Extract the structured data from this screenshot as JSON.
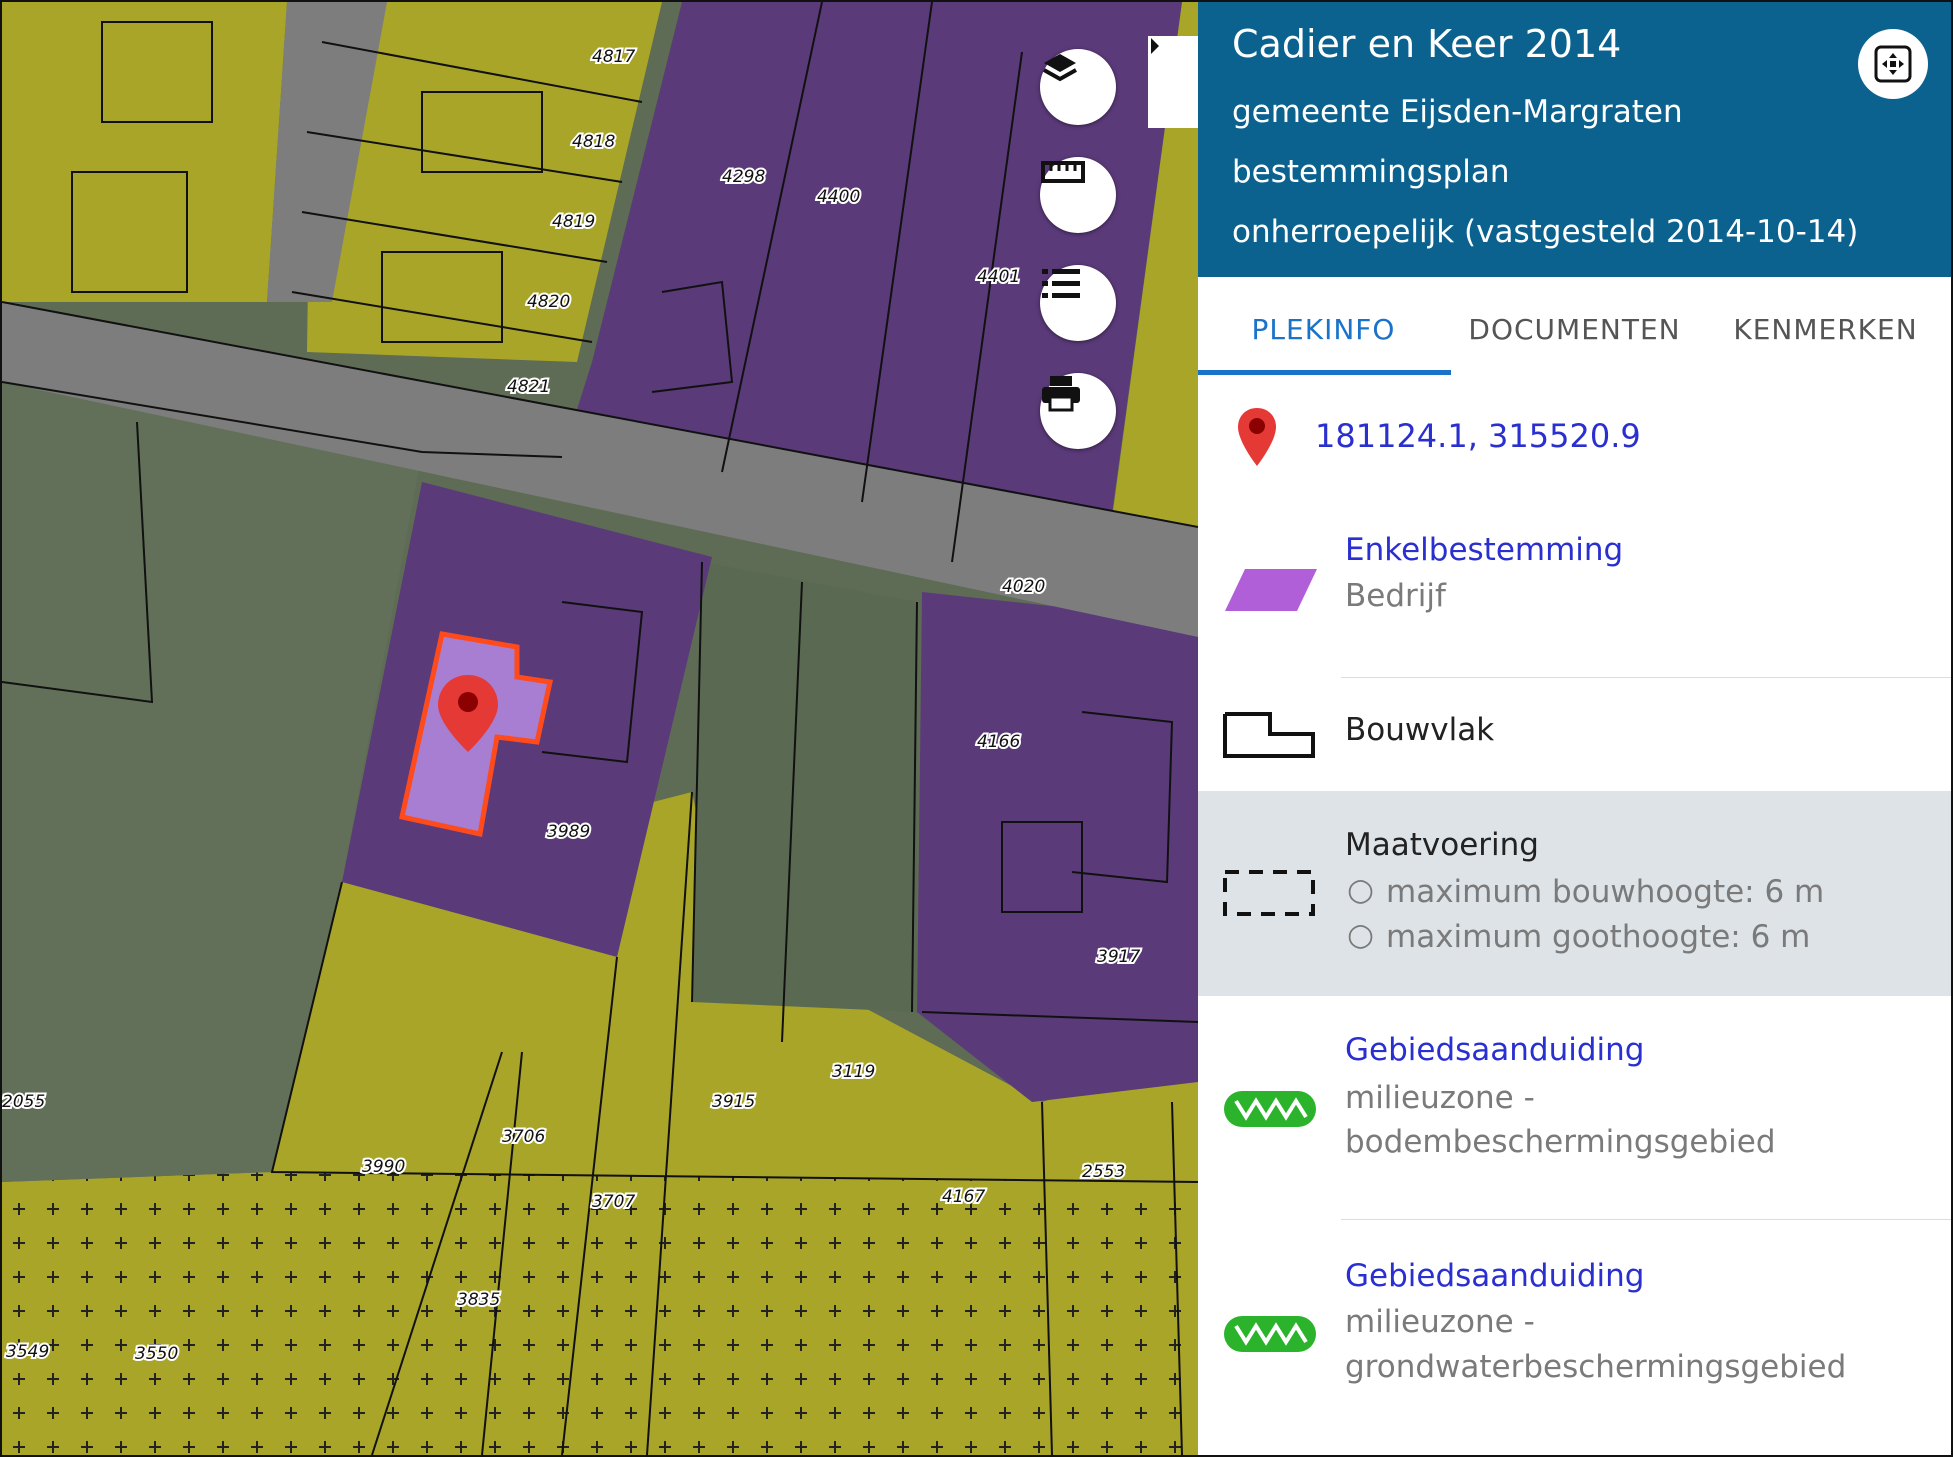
{
  "map": {
    "parcel_labels": [
      "4817",
      "4818",
      "4819",
      "4820",
      "4821",
      "4298",
      "4400",
      "4401",
      "4020",
      "4166",
      "3989",
      "3917",
      "3119",
      "3915",
      "2055",
      "3706",
      "3990",
      "3707",
      "4167",
      "2553",
      "3835",
      "3549",
      "3550"
    ],
    "controls": [
      {
        "name": "layers-icon"
      },
      {
        "name": "ruler-icon"
      },
      {
        "name": "legend-list-icon"
      },
      {
        "name": "printer-icon"
      }
    ],
    "colors": {
      "yellow": "#a9a528",
      "purple": "#5b3a7a",
      "road": "#7d7d7d",
      "grass": "#5e6b55",
      "selection": "#ff4a1c",
      "pin": "#e53935"
    }
  },
  "panel": {
    "header": {
      "title": "Cadier en Keer 2014",
      "line1": "gemeente Eijsden-Margraten",
      "line2": "bestemmingsplan",
      "line3": "onherroepelijk (vastgesteld 2014-10-14)",
      "bg": "#0b628f"
    },
    "tabs": [
      {
        "label": "PLEKINFO",
        "active": true
      },
      {
        "label": "DOCUMENTEN",
        "active": false
      },
      {
        "label": "KENMERKEN",
        "active": false
      }
    ],
    "coordinates": "181124.1, 315520.9",
    "features": {
      "enkel": {
        "title": "Enkelbestemming",
        "sub": "Bedrijf",
        "color": "#b05fd9"
      },
      "bouwvlak": {
        "title": "Bouwvlak"
      },
      "maat": {
        "title": "Maatvoering",
        "items": [
          "maximum bouwhoogte: 6 m",
          "maximum goothoogte: 6 m"
        ]
      },
      "gebied1": {
        "title": "Gebiedsaanduiding",
        "sub1": "milieuzone -",
        "sub2": "bodembeschermingsgebied"
      },
      "gebied2": {
        "title": "Gebiedsaanduiding",
        "sub1": "milieuzone -",
        "sub2": "grondwaterbeschermingsgebied"
      }
    },
    "accent": "#1a73c8",
    "link_color": "#2a2fd0"
  }
}
